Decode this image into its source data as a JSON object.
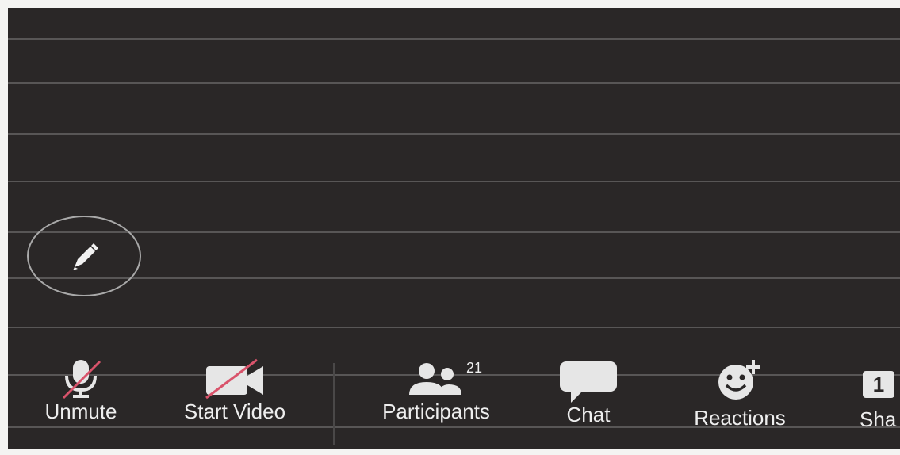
{
  "toolbar": {
    "unmute": {
      "label": "Unmute",
      "icon": "microphone-muted-icon"
    },
    "start_video": {
      "label": "Start Video",
      "icon": "video-off-icon"
    },
    "participants": {
      "label": "Participants",
      "icon": "participants-icon",
      "count": "21"
    },
    "chat": {
      "label": "Chat",
      "icon": "chat-bubble-icon"
    },
    "reactions": {
      "label": "Reactions",
      "icon": "emoji-add-icon"
    },
    "share": {
      "label": "Sha",
      "icon": "share-screen-icon",
      "icon_text": "1"
    }
  },
  "annotate": {
    "icon": "pencil-icon"
  },
  "colors": {
    "background": "#2a2727",
    "icon": "#e6e6e6",
    "muted_slash": "#d9536b",
    "label": "#eeeeee"
  }
}
